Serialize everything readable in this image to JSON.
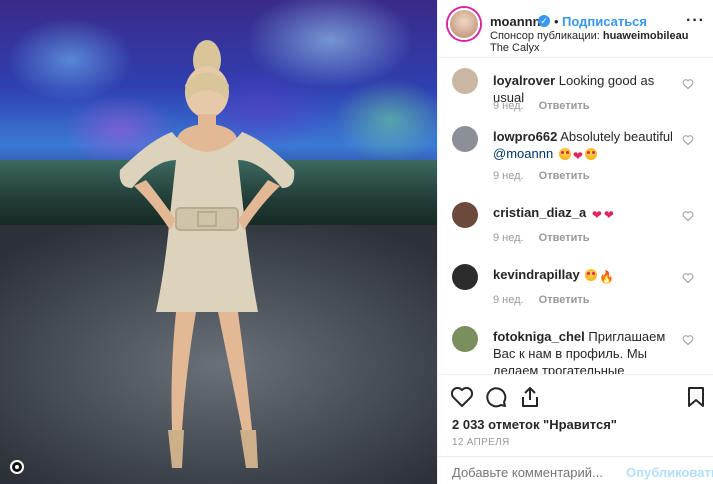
{
  "post": {
    "username": "moannn",
    "verified_badge": "✓",
    "dot": "•",
    "follow_label": "Подписаться",
    "sponsor_prefix": "Спонсор публикации:",
    "sponsor_name": "huaweimobileau",
    "location": "The Calyx",
    "more_label": "···"
  },
  "comments": [
    {
      "user": "loyalrover",
      "text": "Looking good as usual",
      "age": "9 нед.",
      "reply": "Ответить",
      "avatar_color": "#c9b7a2"
    },
    {
      "user": "lowpro662",
      "text": "Absolutely beautiful",
      "mention": "@moannn",
      "emojis": [
        "face",
        "red",
        "face"
      ],
      "age": "9 нед.",
      "reply": "Ответить",
      "avatar_color": "#8c8f97"
    },
    {
      "user": "cristian_diaz_a",
      "text": "",
      "emojis": [
        "red",
        "red"
      ],
      "age": "9 нед.",
      "reply": "Ответить",
      "avatar_color": "#6b4a3a"
    },
    {
      "user": "kevindrapillay",
      "text": "",
      "emojis": [
        "face",
        "fire"
      ],
      "age": "9 нед.",
      "reply": "Ответить",
      "avatar_color": "#2c2c2c"
    },
    {
      "user": "fotokniga_chel",
      "text": "Приглашаем Вас к нам в профиль. Мы делаем трогательные индивидуальные",
      "age": "",
      "reply": "",
      "avatar_color": "#7a8f5c"
    }
  ],
  "emoji_glyphs": {
    "red": "❤",
    "fire": "🔥"
  },
  "actions": {
    "like_icon": "heart-icon",
    "comment_icon": "comment-icon",
    "share_icon": "share-icon",
    "save_icon": "bookmark-icon",
    "likes": "2 033 отметок \"Нравится\"",
    "date": "12 АПРЕЛЯ"
  },
  "add_comment": {
    "placeholder": "Добавьте комментарий...",
    "post_label": "Опубликовать"
  },
  "colors": {
    "accent": "#3897f0",
    "muted": "#999999",
    "border": "#efefef"
  }
}
